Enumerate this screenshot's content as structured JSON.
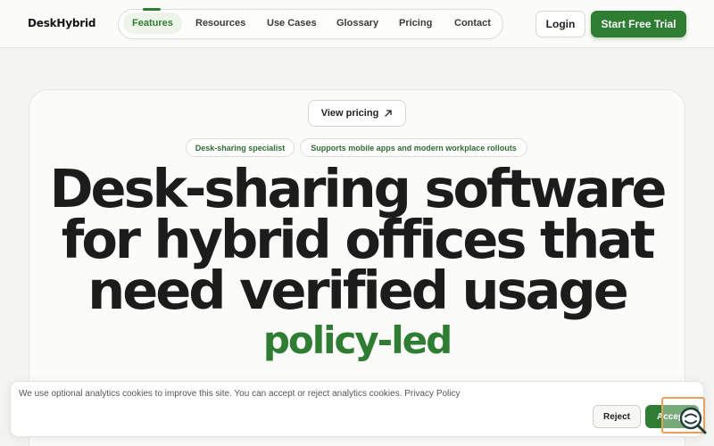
{
  "header": {
    "logo": "DeskHybrid",
    "nav": [
      "Features",
      "Resources",
      "Use Cases",
      "Glossary",
      "Pricing",
      "Contact"
    ],
    "active_nav": "Features",
    "login_label": "Login",
    "cta_label": "Start Free Trial"
  },
  "hero": {
    "pricing_button": "View pricing",
    "tags": [
      "Desk-sharing specialist",
      "Supports mobile apps and modern workplace rollouts"
    ],
    "headline": [
      "Desk-sharing software",
      "for hybrid offices that",
      "need verified usage"
    ],
    "accent": "policy-led"
  },
  "cookie": {
    "text": "We use optional analytics cookies to improve this site. You can accept or reject analytics cookies.",
    "link": "Privacy Policy",
    "reject_label": "Reject",
    "accept_label": "Accept"
  },
  "colors": {
    "brand_green": "#2e7d32",
    "background": "#f4f4f2",
    "text_dark": "#1c1c1c",
    "widget_border": "#e8a15a"
  },
  "icons": [
    "arrow-up-right-icon",
    "chat-search-icon"
  ]
}
